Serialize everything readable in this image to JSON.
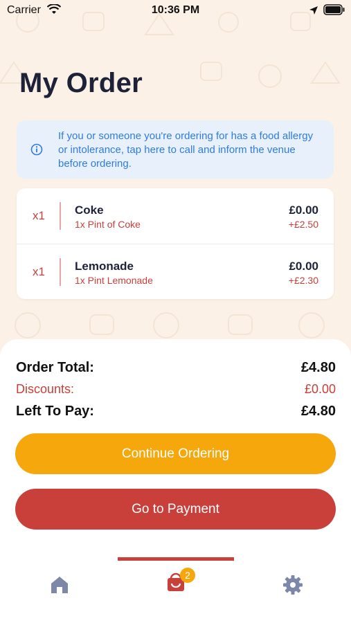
{
  "status_bar": {
    "carrier": "Carrier",
    "time": "10:36 PM"
  },
  "page": {
    "title": "My Order"
  },
  "allergy_notice": {
    "icon": "info-icon",
    "text": "If you or someone you're ordering for has a food allergy or intolerance, tap here to call and inform the venue before ordering."
  },
  "order_items": [
    {
      "qty": "x1",
      "name": "Coke",
      "detail": "1x Pint of Coke",
      "price": "£0.00",
      "extra": "+£2.50"
    },
    {
      "qty": "x1",
      "name": "Lemonade",
      "detail": "1x Pint Lemonade",
      "price": "£0.00",
      "extra": "+£2.30"
    }
  ],
  "summary": {
    "total_label": "Order Total:",
    "total_value": "£4.80",
    "discount_label": "Discounts:",
    "discount_value": "£0.00",
    "left_label": "Left To Pay:",
    "left_value": "£4.80"
  },
  "buttons": {
    "continue": "Continue Ordering",
    "payment": "Go to Payment"
  },
  "tab_bar": {
    "active_tab": "basket",
    "basket_badge": "2",
    "tabs": [
      {
        "name": "home",
        "icon": "home-icon"
      },
      {
        "name": "basket",
        "icon": "basket-icon"
      },
      {
        "name": "settings",
        "icon": "gear-icon"
      }
    ]
  },
  "colors": {
    "accent_red": "#c9403b",
    "accent_yellow": "#f5a70b",
    "info_blue": "#2d7be6",
    "background": "#fbf1e6"
  }
}
